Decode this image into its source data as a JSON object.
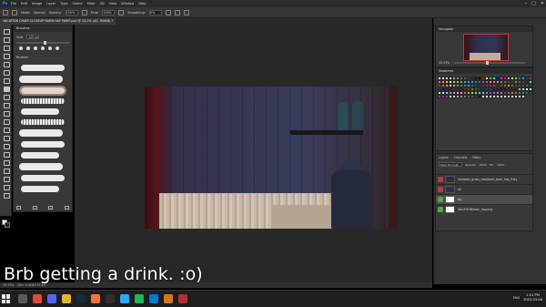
{
  "menubar": {
    "app_logo": "Ps",
    "items": [
      "File",
      "Edit",
      "Image",
      "Layer",
      "Type",
      "Select",
      "Filter",
      "3D",
      "View",
      "Window",
      "Help"
    ],
    "window_controls": [
      "–",
      "□",
      "✕"
    ]
  },
  "options": {
    "mode_label": "Mode:",
    "mode_value": "Normal",
    "opacity_label": "Opacity:",
    "opacity_value": "100%",
    "flow_label": "Flow:",
    "flow_value": "100%",
    "smoothing_label": "Smoothing:",
    "smoothing_value": "0%"
  },
  "document_tab": "VACATION CHAIR CLOSEUP BARN HAY PAINT.psd @ 33.3% (42, RGB/8) *",
  "brushes": {
    "title": "Brushes",
    "size_label": "Size:",
    "size_value": "125 px",
    "folder": "Brushes"
  },
  "navigator": {
    "title": "Navigator",
    "zoom": "33.33%"
  },
  "swatches": {
    "title": "Swatches",
    "colors": [
      "#ffffff",
      "#f2f2f2",
      "#d9d9d9",
      "#bfbfbf",
      "#a6a6a6",
      "#8c8c8c",
      "#737373",
      "#595959",
      "#404040",
      "#262626",
      "#0d0d0d",
      "#000000",
      "#ff0000",
      "#ffff00",
      "#00ff00",
      "#00ffff",
      "#0000ff",
      "#ff00ff",
      "#ed1c24",
      "#f7941d",
      "#fff200",
      "#8dc63f",
      "#00a651",
      "#00aeef",
      "#2e3192",
      "#92278f",
      "#f26c4f",
      "#f68e55",
      "#fbaf5c",
      "#fff467",
      "#acd372",
      "#7cc576",
      "#3bb878",
      "#1abbb4",
      "#00bff3",
      "#438ccb",
      "#5574b9",
      "#605ca8",
      "#855fa8",
      "#a763a8",
      "#f06ea9",
      "#f26d7d",
      "#c69c6d",
      "#a67c52",
      "#8c6239",
      "#754c24",
      "#603913",
      "#998675",
      "#736357",
      "#534741",
      "#362f2d",
      "#c7b299",
      "#ed145b",
      "#f26522",
      "#f7941d",
      "#ffde17",
      "#8dc63f",
      "#39b54a",
      "#00a651",
      "#00a99d",
      "#00aeef",
      "#0072bc",
      "#0054a6",
      "#2e3192",
      "#662d91",
      "#92278f",
      "#ec008c",
      "#ed145b",
      "#9e0b0f",
      "#a0410d",
      "#a36209",
      "#aba000",
      "#598527",
      "#197b30",
      "#007236",
      "#00746b",
      "#0076a3",
      "#004b80",
      "#003471",
      "#1b1464",
      "#440e62",
      "#630460",
      "#9e005d",
      "#9e0039",
      "#790000",
      "#7b2e00",
      "#7d4900",
      "#827b00",
      "#406618",
      "#005e20",
      "#005826",
      "#005952",
      "#005b7f",
      "#003663",
      "#002157",
      "#0d004c",
      "#32004b",
      "#4b0049",
      "#7b0046",
      "#7a0026",
      "#ff9999",
      "#ffcc99",
      "#ffff99",
      "#ccff99",
      "#99ffcc",
      "#99ffff",
      "#99ccff",
      "#9999ff",
      "#cc99ff",
      "#ff99ff",
      "#ff99cc",
      "#cc6666",
      "#cc9966",
      "#cccc66",
      "#99cc66",
      "#66cc99",
      "#66cccc",
      "#6699cc",
      "#6666cc",
      "#9966cc",
      "#cc66cc",
      "#cc6699",
      "#993333",
      "#996633",
      "#999933",
      "#669933",
      "#339966",
      "#339999",
      "#336699",
      "#333399",
      "#663399",
      "#993399",
      "#993366",
      "#e6e6e6",
      "#cccccc",
      "#b3b3b3",
      "#999999",
      "#808080",
      "#666666",
      "#4d4d4d",
      "#333333",
      "#1a1a1a",
      "#ffe0e0",
      "#ffe8d0",
      "#fffbd0",
      "#e6ffd0",
      "#d0ffe8",
      "#d0ffff",
      "#d0e8ff",
      "#d0d0ff",
      "#e8d0ff",
      "#ffd0ff",
      "#ffd0e8",
      "#f5f5dc"
    ]
  },
  "layers": {
    "tabs": [
      "Layers",
      "Channels",
      "Paths"
    ],
    "blend_mode": "Pass Through",
    "opacity_label": "Opacity:",
    "opacity_value": "100%",
    "fill_label": "Fill:",
    "fill_value": "100%",
    "items": [
      {
        "name": "vacation_grass_new/barn_barn_hay_frsty",
        "thumb": "dark",
        "eye": "red"
      },
      {
        "name": "ref",
        "thumb": "dark",
        "eye": "red"
      },
      {
        "name": "bg",
        "thumb": "white",
        "eye": "green"
      },
      {
        "name": "VACATION/barn_hay.png",
        "thumb": "white",
        "eye": "green"
      }
    ]
  },
  "status": {
    "zoom": "33.33%",
    "doc": "Doc: 4.04M/135.4M"
  },
  "caption": "Brb getting a drink. :o)",
  "taskbar": {
    "icons": [
      {
        "name": "search-icon",
        "color": "#5a5a5a"
      },
      {
        "name": "chrome-icon",
        "color": "#e04a3c"
      },
      {
        "name": "discord-icon",
        "color": "#5865f2"
      },
      {
        "name": "explorer-icon",
        "color": "#e2b43a"
      },
      {
        "name": "steam-icon",
        "color": "#1b2838"
      },
      {
        "name": "firefox-icon",
        "color": "#ff7139"
      },
      {
        "name": "obs-icon",
        "color": "#302e31"
      },
      {
        "name": "photoshop-icon",
        "color": "#31a8ff"
      },
      {
        "name": "spotify-icon",
        "color": "#1db954"
      },
      {
        "name": "vscode-icon",
        "color": "#0078d4"
      },
      {
        "name": "paint-icon",
        "color": "#d0782a"
      },
      {
        "name": "game-icon",
        "color": "#b0303a"
      }
    ],
    "language": "ENG",
    "time": "2:51 PM",
    "date": "2023-03-08"
  }
}
